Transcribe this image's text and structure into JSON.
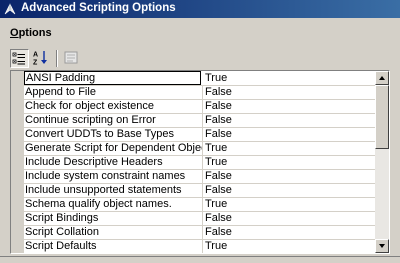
{
  "window": {
    "title": "Advanced Scripting Options"
  },
  "section": {
    "title_underlined": "O",
    "title_rest": "ptions"
  },
  "toolbar": {
    "categorized_pressed": true
  },
  "properties": [
    {
      "name": "ANSI Padding",
      "value": "True"
    },
    {
      "name": "Append to File",
      "value": "False"
    },
    {
      "name": "Check for object existence",
      "value": "False"
    },
    {
      "name": "Continue scripting on Error",
      "value": "False"
    },
    {
      "name": "Convert UDDTs to Base Types",
      "value": "False"
    },
    {
      "name": "Generate Script for Dependent Objects",
      "value": "True"
    },
    {
      "name": "Include Descriptive Headers",
      "value": "True"
    },
    {
      "name": "Include system constraint names",
      "value": "False"
    },
    {
      "name": "Include unsupported statements",
      "value": "False"
    },
    {
      "name": "Schema qualify object names.",
      "value": "True"
    },
    {
      "name": "Script Bindings",
      "value": "False"
    },
    {
      "name": "Script Collation",
      "value": "False"
    },
    {
      "name": "Script Defaults",
      "value": "True"
    }
  ],
  "colors": {
    "title_start": "#0a246a",
    "title_end": "#3a6ea5",
    "face": "#d4d0c8"
  },
  "icons": {
    "app": "ssms-icon",
    "categorized": "categorized-icon",
    "alphabetical": "alphabetical-sort-icon",
    "pages": "property-pages-icon"
  }
}
